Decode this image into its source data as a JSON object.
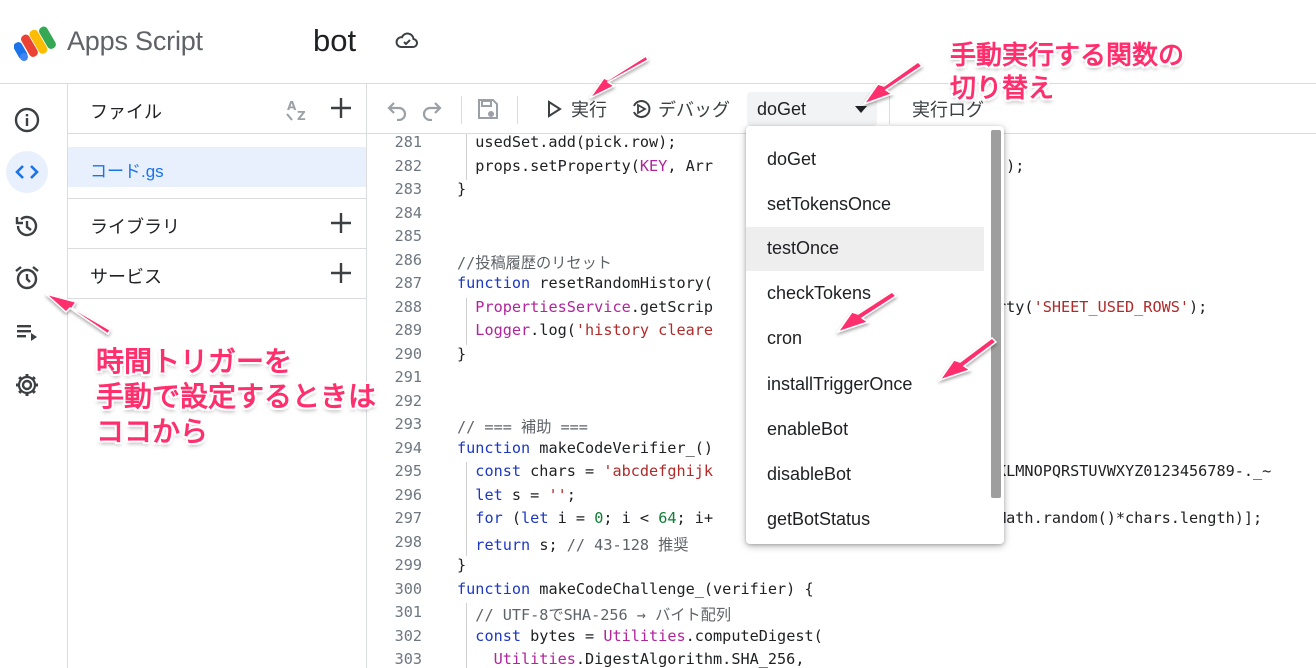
{
  "header": {
    "app_name": "Apps Script",
    "project_name": "bot"
  },
  "rail": {
    "items": [
      "overview",
      "editor",
      "executions-history",
      "triggers",
      "executions",
      "project-settings"
    ],
    "active": "editor"
  },
  "files_panel": {
    "files_label": "ファイル",
    "file_name": "コード.gs",
    "libraries_label": "ライブラリ",
    "services_label": "サービス"
  },
  "toolbar": {
    "run_label": "実行",
    "debug_label": "デバッグ",
    "selected_function": "doGet",
    "log_label": "実行ログ"
  },
  "dropdown": {
    "items": [
      "doGet",
      "setTokensOnce",
      "testOnce",
      "checkTokens",
      "cron",
      "installTriggerOnce",
      "enableBot",
      "disableBot",
      "getBotStatus"
    ],
    "hovered": "testOnce"
  },
  "code": {
    "lines": [
      {
        "n": "281",
        "t": "  usedSet.add(pick.row);"
      },
      {
        "n": "282",
        "t": "  props.setProperty(KEY, Arr"
      },
      {
        "n": "283",
        "t": "}"
      },
      {
        "n": "284",
        "t": ""
      },
      {
        "n": "285",
        "t": ""
      },
      {
        "n": "286",
        "t": "//投稿履歴のリセット"
      },
      {
        "n": "287",
        "t": "function resetRandomHistory("
      },
      {
        "n": "288",
        "t": "  PropertiesService.getScrip"
      },
      {
        "n": "289",
        "t": "  Logger.log('history cleare"
      },
      {
        "n": "290",
        "t": "}"
      },
      {
        "n": "291",
        "t": ""
      },
      {
        "n": "292",
        "t": ""
      },
      {
        "n": "293",
        "t": "// === 補助 ==="
      },
      {
        "n": "294",
        "t": "function makeCodeVerifier_()"
      },
      {
        "n": "295",
        "t": "  const chars = 'abcdefghijk"
      },
      {
        "n": "296",
        "t": "  let s = '';"
      },
      {
        "n": "297",
        "t": "  for (let i = 0; i < 64; i+"
      },
      {
        "n": "298",
        "t": "  return s; // 43-128 推奨"
      },
      {
        "n": "299",
        "t": "}"
      },
      {
        "n": "300",
        "t": "function makeCodeChallenge_(verifier) {"
      },
      {
        "n": "301",
        "t": "  // UTF-8でSHA-256 → バイト配列"
      },
      {
        "n": "302",
        "t": "  const bytes = Utilities.computeDigest("
      },
      {
        "n": "303",
        "t": "    Utilities.DigestAlgorithm.SHA_256,"
      }
    ],
    "right_fragments": {
      "282": "));",
      "288": "rty('SHEET_USED_ROWS');",
      "295": "KLMNOPQRSTUVWXYZ0123456789-._~",
      "297": "Math.random()*chars.length)];"
    }
  },
  "annotations": {
    "top": [
      "手動実行する関数の",
      "切り替え"
    ],
    "left": [
      "時間トリガーを",
      "手動で設定するときは",
      "ココから"
    ]
  },
  "colors": {
    "accent": "#1a73e8",
    "annotation": "#ff2f6d",
    "active_bg": "#e8f0fe"
  }
}
